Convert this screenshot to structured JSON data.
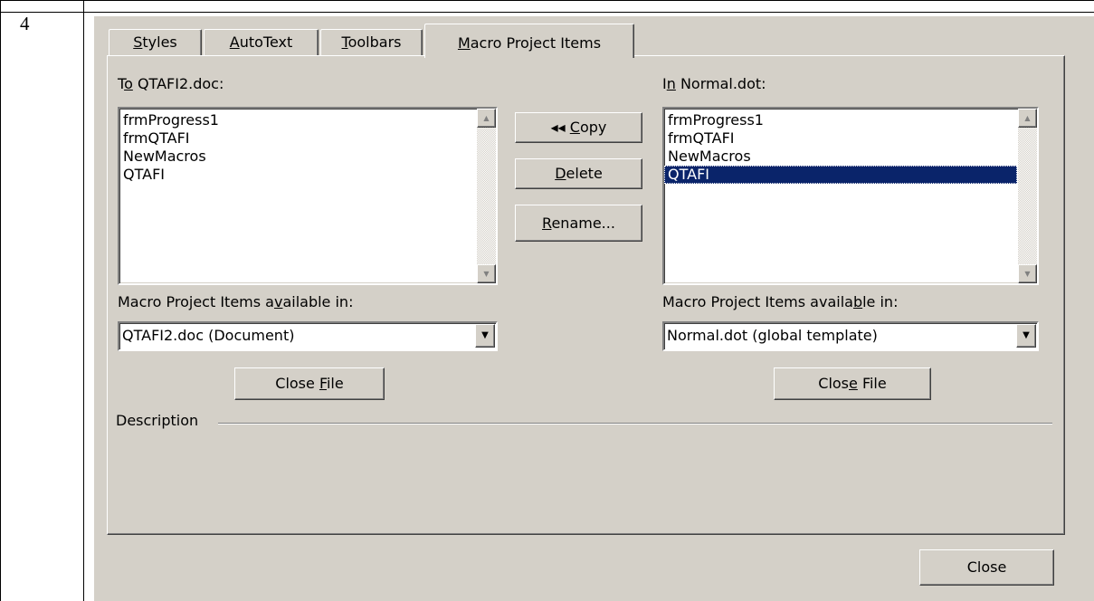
{
  "row_number": "4",
  "tabs": [
    {
      "pre": "",
      "key": "S",
      "post": "tyles"
    },
    {
      "pre": "",
      "key": "A",
      "post": "utoText"
    },
    {
      "pre": "",
      "key": "T",
      "post": "oolbars"
    },
    {
      "pre": "",
      "key": "M",
      "post": "acro Project Items"
    }
  ],
  "left": {
    "label": {
      "pre": "T",
      "key": "o",
      "post": " QTAFI2.doc:"
    },
    "items": [
      "frmProgress1",
      "frmQTAFI",
      "NewMacros",
      "QTAFI"
    ],
    "available_label": {
      "pre": "Macro Project Items a",
      "key": "v",
      "post": "ailable in:"
    },
    "combo_value": "QTAFI2.doc (Document)",
    "close_file": {
      "pre": "Close ",
      "key": "F",
      "post": "ile"
    }
  },
  "right": {
    "label": {
      "pre": "I",
      "key": "n",
      "post": " Normal.dot:"
    },
    "items": [
      "frmProgress1",
      "frmQTAFI",
      "NewMacros",
      "QTAFI"
    ],
    "selected_index": 3,
    "available_label": {
      "pre": "Macro Project Items availa",
      "key": "b",
      "post": "le in:"
    },
    "combo_value": "Normal.dot (global template)",
    "close_file": {
      "pre": "Clos",
      "key": "e",
      "post": " File"
    }
  },
  "middle_buttons": {
    "copy": {
      "prefix": "◂◂ ",
      "key": "C",
      "post": "opy"
    },
    "delete": {
      "pre": "",
      "key": "D",
      "post": "elete"
    },
    "rename": {
      "pre": "",
      "key": "R",
      "post": "ename..."
    }
  },
  "description_label": "Description",
  "close_button": "Close",
  "icons": {
    "scroll_up": "▲",
    "scroll_down": "▼",
    "dropdown": "▼"
  }
}
